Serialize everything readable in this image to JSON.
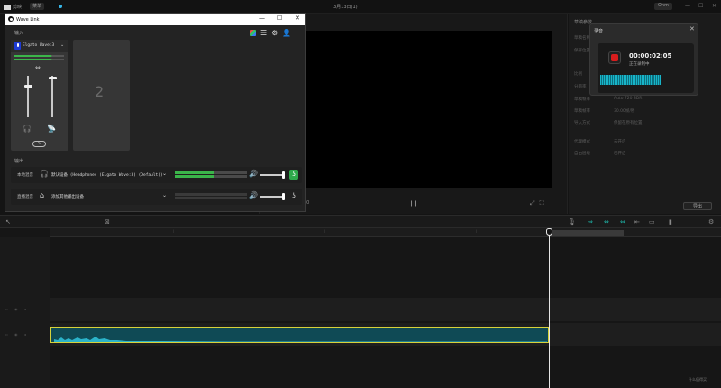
{
  "editor": {
    "app_logo": "剪映",
    "menu_label": "菜单",
    "project_title": "3月13日(1)",
    "right_badge": "Ohm",
    "preview_time": "00",
    "props": {
      "title": "草稿参数",
      "rows": [
        {
          "label": "草稿名称",
          "value": ""
        },
        {
          "label": "保存位置",
          "value": ""
        },
        {
          "label": "比例",
          "value": ""
        },
        {
          "label": "分辨率",
          "value": ""
        },
        {
          "label": "草稿帧率",
          "value": "Auto 720 SDR"
        },
        {
          "label": "草稿帧率",
          "value": "30.00帧/秒"
        },
        {
          "label": "导入方式",
          "value": "保留在原有位置"
        },
        {
          "label": "代理模式",
          "value": "未开启"
        },
        {
          "label": "自由层级",
          "value": "已开启"
        }
      ],
      "export_label": "导出"
    },
    "watermark": "什么值得买"
  },
  "recording": {
    "title": "录音",
    "time": "00:00:02:05",
    "status": "正在录制中",
    "level_fraction": 0.63
  },
  "wavelink": {
    "title": "Wave Link",
    "input_label": "输入",
    "output_label": "输出",
    "channel": {
      "device": "Elgato Wave:3",
      "meter_fraction": 0.75,
      "fader_a_fraction": 0.75,
      "fader_b_fraction": 0.95
    },
    "empty_slot_number": "2",
    "outputs": [
      {
        "label": "本地混音",
        "device": "默认设备 (Headphones (Elgato Wave:3) (Default))",
        "meter_fraction": 0.55,
        "volume_fraction": 0.96,
        "monitor_active": true
      },
      {
        "label": "直播混音",
        "device": "添加其他输出设备",
        "meter_fraction": 0.0,
        "volume_fraction": 0.96,
        "monitor_active": false
      }
    ]
  }
}
